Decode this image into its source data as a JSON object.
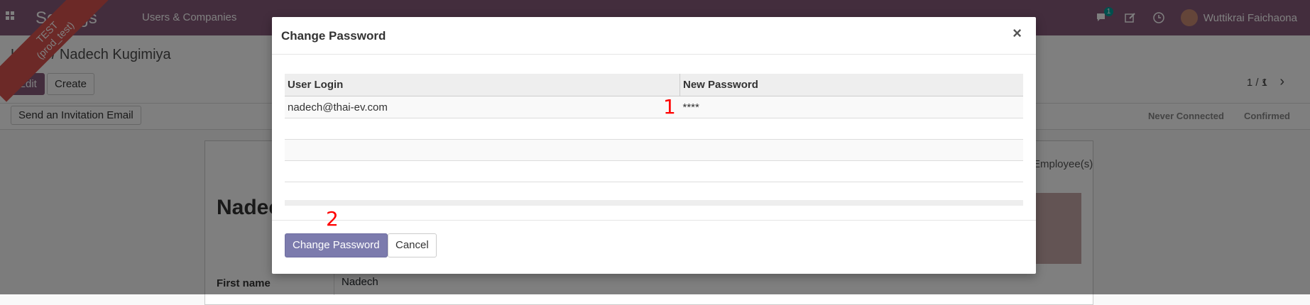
{
  "navbar": {
    "app_name": "Settings",
    "menu_users": "Users & Companies",
    "chat_count": "1",
    "user_name": "Wuttikrai Faichaona",
    "color": "#875a7b"
  },
  "ribbon": {
    "line1": "TEST",
    "line2": "(prod_test)"
  },
  "control_panel": {
    "breadcrumb": "Users / Nadech Kugimiya",
    "edit_label": "Edit",
    "create_label": "Create",
    "pager": "1 / 1"
  },
  "status_bar": {
    "send_invite_label": "Send an Invitation Email",
    "states": [
      "Never Connected",
      "Confirmed"
    ]
  },
  "sheet": {
    "title": "Nadech Kugimiya",
    "tab_label": "Employee(s)",
    "first_name_label": "First name",
    "first_name_value": "Nadech"
  },
  "modal": {
    "title": "Change Password",
    "close_glyph": "×",
    "columns": {
      "login": "User Login",
      "new_password": "New Password"
    },
    "rows": [
      {
        "login": "nadech@thai-ev.com",
        "new_password": "****"
      }
    ],
    "change_button": "Change Password",
    "cancel_button": "Cancel"
  },
  "annotations": {
    "mark1": "1",
    "mark2": "2",
    "color": "#ff0000"
  }
}
